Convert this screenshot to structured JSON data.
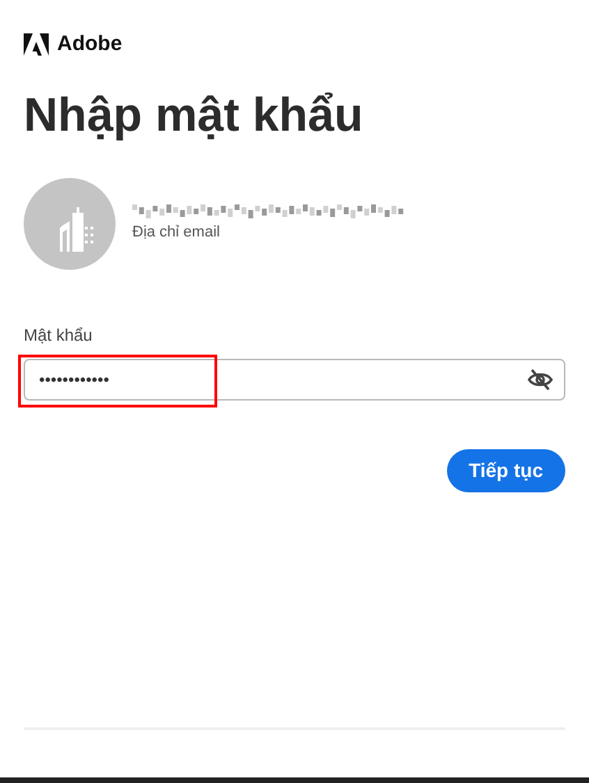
{
  "brand": {
    "name": "Adobe"
  },
  "title": "Nhập mật khẩu",
  "account": {
    "email_label": "Địa chỉ email"
  },
  "password": {
    "label": "Mật khẩu",
    "value": "••••••••••••",
    "highlighted": true
  },
  "buttons": {
    "continue": "Tiếp tục"
  }
}
